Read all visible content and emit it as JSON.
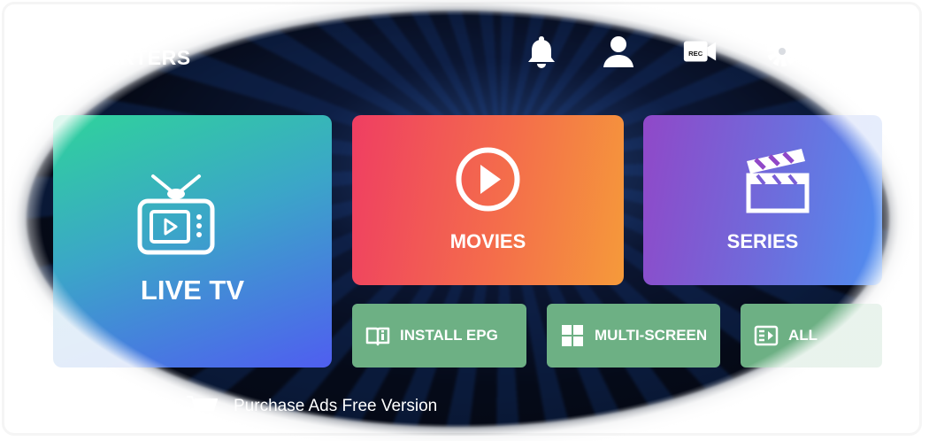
{
  "header": {
    "brand": "ARTERS",
    "icons": [
      "bell-icon",
      "user-icon",
      "record-icon",
      "gear-icon"
    ]
  },
  "tiles": {
    "live_tv": {
      "label": "LIVE TV",
      "icon": "tv-icon"
    },
    "movies": {
      "label": "MOVIES",
      "icon": "play-circle-icon"
    },
    "series": {
      "label": "SERIES",
      "icon": "clapperboard-icon"
    }
  },
  "actions": {
    "install_epg": {
      "label": "INSTALL EPG",
      "icon": "book-icon"
    },
    "multi_screen": {
      "label": "MULTI-SCREEN",
      "icon": "grid-icon"
    },
    "all": {
      "label": "ALL",
      "icon": "list-icon"
    }
  },
  "footer": {
    "purchase": "Purchase Ads Free Version",
    "icon": "cart-icon"
  },
  "record_badge": "REC",
  "colors": {
    "background": "#050a18",
    "live_tv_gradient": [
      "#2fd39b",
      "#4f5ef0"
    ],
    "movies_gradient": [
      "#ef3e62",
      "#f59a3a"
    ],
    "series_gradient": [
      "#9048c8",
      "#4f8ff0"
    ],
    "action_green": "#6db084"
  }
}
